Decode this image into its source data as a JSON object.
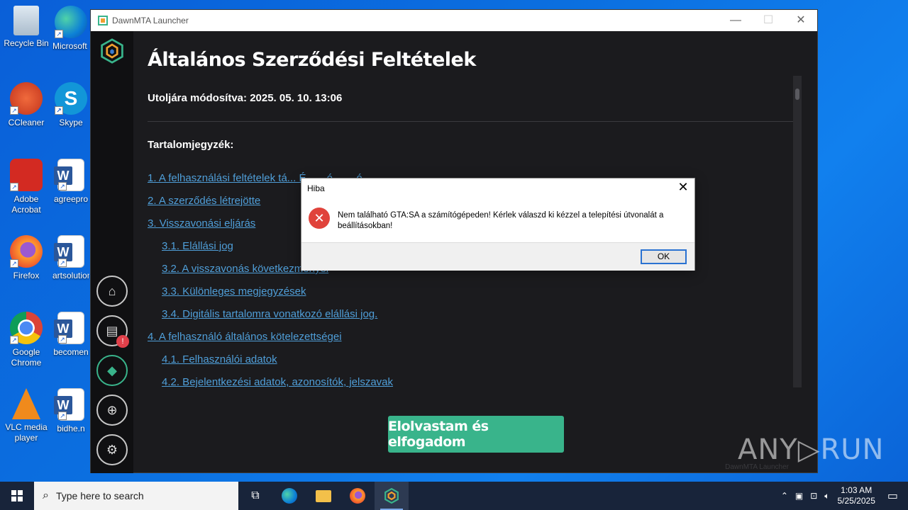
{
  "desktop": {
    "icons": [
      {
        "label": "Recycle Bin"
      },
      {
        "label": "Microsoft Edge"
      },
      {
        "label": "CCleaner"
      },
      {
        "label": "Skype"
      },
      {
        "label": "Adobe Acrobat"
      },
      {
        "label": "agreepro"
      },
      {
        "label": "Firefox"
      },
      {
        "label": "artsolution"
      },
      {
        "label": "Google Chrome"
      },
      {
        "label": "becomen"
      },
      {
        "label": "VLC media player"
      },
      {
        "label": "bidhe.n"
      }
    ]
  },
  "window": {
    "title": "DawnMTA Launcher",
    "heading": "Általános Szerződési Feltételek",
    "modified": "Utoljára módosítva: 2025. 05. 10. 13:06",
    "toc_title": "Tartalomjegyzék:",
    "toc": [
      {
        "label": "1. A felhasználási feltételek tá... É... ...é ... ...ó..."
      },
      {
        "label": "2. A szerződés létrejötte"
      },
      {
        "label": "3. Visszavonási eljárás"
      },
      {
        "label": "3.1. Elállási jog"
      },
      {
        "label": "3.2. A visszavonás következményei"
      },
      {
        "label": "3.3. Különleges megjegyzések"
      },
      {
        "label": "3.4. Digitális tartalomra vonatkozó elállási jog."
      },
      {
        "label": "4. A felhasználó általános kötelezettségei"
      },
      {
        "label": "4.1. Felhasználói adatok"
      },
      {
        "label": "4.2. Bejelentkezési adatok, azonosítók, jelszavak"
      }
    ],
    "accept_button": "Elolvastam és elfogadom",
    "footer_text": "DawnMTA Launcher",
    "sidebar_badge": "!"
  },
  "dialog": {
    "title": "Hiba",
    "message": "Nem található GTA:SA a számítógépeden! Kérlek válaszd ki kézzel a telepítési útvonalát a beállításokban!",
    "ok_label": "OK"
  },
  "watermark": "ANY▷RUN",
  "taskbar": {
    "search_placeholder": "Type here to search",
    "time": "1:03 AM",
    "date": "5/25/2025"
  },
  "colors": {
    "accent_green": "#39b48b",
    "link_blue": "#4f9ed8",
    "badge_red": "#e0404a"
  }
}
